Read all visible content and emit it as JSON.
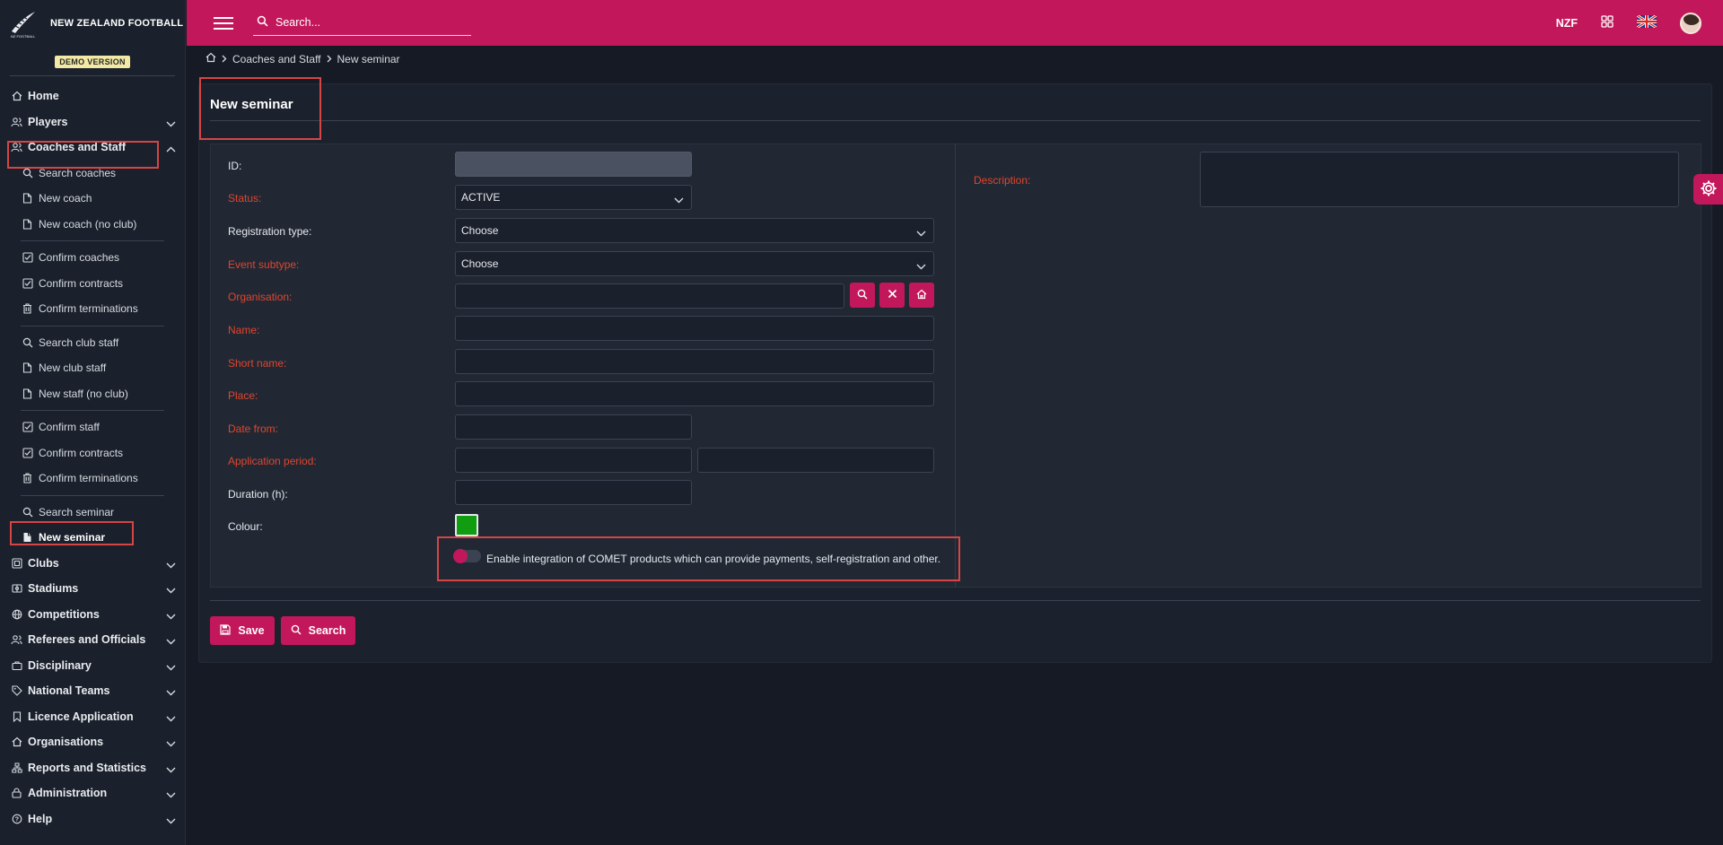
{
  "app": {
    "org_name": "NEW ZEALAND FOOTBALL",
    "demo_badge": "DEMO VERSION"
  },
  "topbar": {
    "search_placeholder": "Search...",
    "currency": "NZF"
  },
  "sidebar": {
    "home": "Home",
    "players": "Players",
    "coaches_and_staff": "Coaches and Staff",
    "sub": {
      "search_coaches": "Search coaches",
      "new_coach": "New coach",
      "new_coach_no_club": "New coach (no club)",
      "confirm_coaches": "Confirm coaches",
      "confirm_contracts_1": "Confirm contracts",
      "confirm_terminations_1": "Confirm terminations",
      "search_club_staff": "Search club staff",
      "new_club_staff": "New club staff",
      "new_staff_no_club": "New staff (no club)",
      "confirm_staff": "Confirm staff",
      "confirm_contracts_2": "Confirm contracts",
      "confirm_terminations_2": "Confirm terminations",
      "search_seminar": "Search seminar",
      "new_seminar": "New seminar"
    },
    "clubs": "Clubs",
    "stadiums": "Stadiums",
    "competitions": "Competitions",
    "referees": "Referees and Officials",
    "disciplinary": "Disciplinary",
    "national_teams": "National Teams",
    "licence_application": "Licence Application",
    "organisations": "Organisations",
    "reports": "Reports and Statistics",
    "administration": "Administration",
    "help": "Help"
  },
  "breadcrumb": {
    "section": "Coaches and Staff",
    "page": "New seminar"
  },
  "form": {
    "title": "New seminar",
    "labels": {
      "id": "ID:",
      "status": "Status:",
      "registration_type": "Registration type:",
      "event_subtype": "Event subtype:",
      "organisation": "Organisation:",
      "name": "Name:",
      "short_name": "Short name:",
      "place": "Place:",
      "date_from": "Date from:",
      "application_period": "Application period:",
      "duration": "Duration (h):",
      "colour": "Colour:",
      "description": "Description:"
    },
    "values": {
      "id": "",
      "status": "ACTIVE",
      "registration_type": "Choose",
      "event_subtype": "Choose",
      "colour": "#109e10"
    },
    "integration_toggle_label": "Enable integration of COMET products which can provide payments, self-registration and other.",
    "integration_enabled": false
  },
  "actions": {
    "save": "Save",
    "search": "Search"
  }
}
